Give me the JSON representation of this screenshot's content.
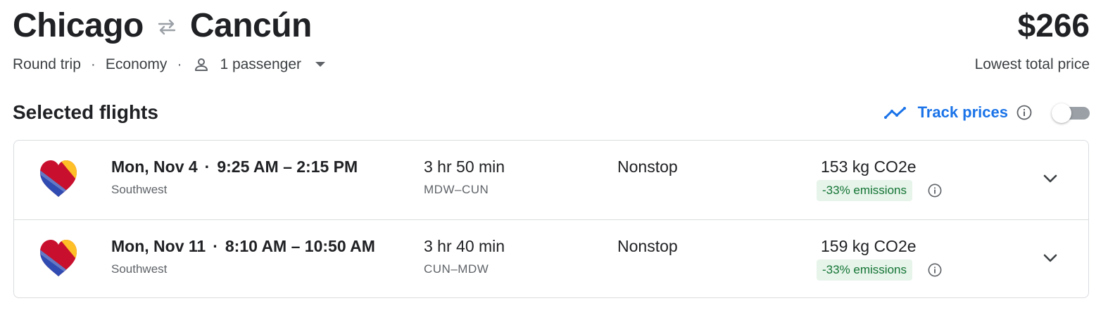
{
  "header": {
    "origin": "Chicago",
    "destination": "Cancún",
    "price": "$266",
    "price_caption": "Lowest total price"
  },
  "options": {
    "trip_type": "Round trip",
    "cabin": "Economy",
    "passengers": "1 passenger",
    "separator": "·"
  },
  "selected": {
    "title": "Selected flights",
    "track_label": "Track prices",
    "track_enabled": false
  },
  "flights": [
    {
      "date": "Mon, Nov 4",
      "times": "9:25 AM – 2:15 PM",
      "airline": "Southwest",
      "duration": "3 hr 50 min",
      "route": "MDW–CUN",
      "stops": "Nonstop",
      "emissions": "153 kg CO2e",
      "emissions_delta": "-33% emissions"
    },
    {
      "date": "Mon, Nov 11",
      "times": "8:10 AM – 10:50 AM",
      "airline": "Southwest",
      "duration": "3 hr 40 min",
      "route": "CUN–MDW",
      "stops": "Nonstop",
      "emissions": "159 kg CO2e",
      "emissions_delta": "-33% emissions"
    }
  ],
  "icons": {
    "swap": "swap-arrows-icon",
    "person": "person-icon",
    "caret": "caret-down-icon",
    "trend": "trending-line-icon",
    "info": "info-icon",
    "chevron": "chevron-down-icon",
    "airline_logo": "southwest-heart-logo"
  },
  "colors": {
    "accent": "#1a73e8",
    "emissions_badge_bg": "#e6f4ea",
    "emissions_badge_text": "#137333",
    "logo_blue": "#304cb2",
    "logo_red": "#c8102e",
    "logo_yellow": "#ffbf27"
  }
}
